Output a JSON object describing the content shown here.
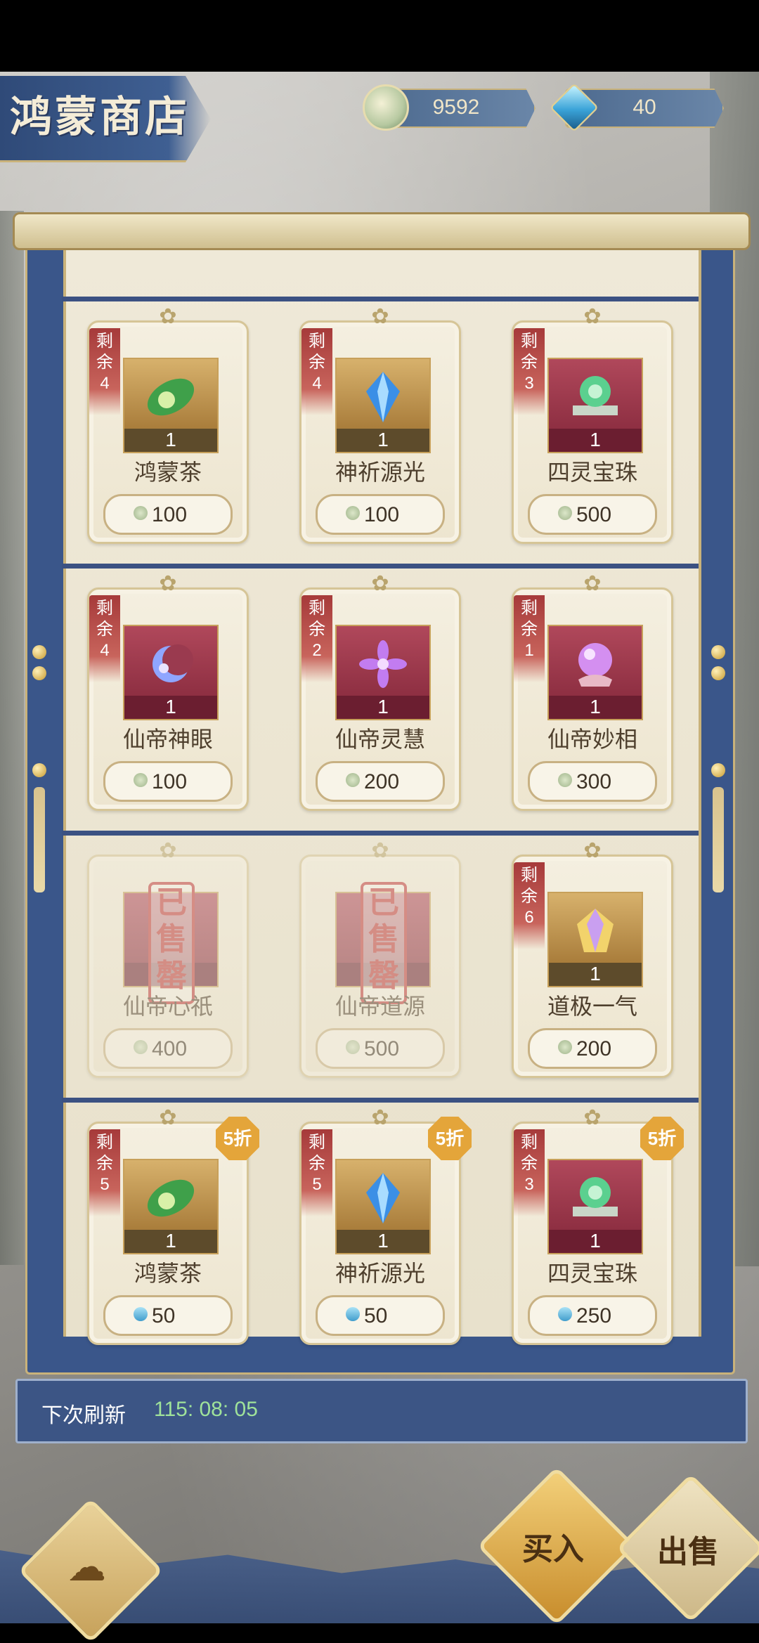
{
  "header": {
    "title": "鸿蒙商店",
    "currencies": [
      {
        "icon": "jade-coin-icon",
        "value": "9592"
      },
      {
        "icon": "gem-icon",
        "value": "40"
      }
    ]
  },
  "shop": {
    "items": [
      {
        "remain_label": "剩余",
        "remain": "4",
        "qty": "1",
        "name": "鸿蒙茶",
        "price": "100",
        "currency": "jade-coin-icon",
        "sold": false
      },
      {
        "remain_label": "剩余",
        "remain": "4",
        "qty": "1",
        "name": "神祈源光",
        "price": "100",
        "currency": "jade-coin-icon",
        "sold": false
      },
      {
        "remain_label": "剩余",
        "remain": "3",
        "qty": "1",
        "name": "四灵宝珠",
        "price": "500",
        "currency": "jade-coin-icon",
        "sold": false
      },
      {
        "remain_label": "剩余",
        "remain": "4",
        "qty": "1",
        "name": "仙帝神眼",
        "price": "100",
        "currency": "jade-coin-icon",
        "sold": false
      },
      {
        "remain_label": "剩余",
        "remain": "2",
        "qty": "1",
        "name": "仙帝灵慧",
        "price": "200",
        "currency": "jade-coin-icon",
        "sold": false
      },
      {
        "remain_label": "剩余",
        "remain": "1",
        "qty": "1",
        "name": "仙帝妙相",
        "price": "300",
        "currency": "jade-coin-icon",
        "sold": false
      },
      {
        "stamp": "已售罄",
        "name": "仙帝心祇",
        "price": "400",
        "currency": "jade-coin-icon",
        "sold": true
      },
      {
        "stamp": "已售罄",
        "name": "仙帝道源",
        "price": "500",
        "currency": "jade-coin-icon",
        "sold": true
      },
      {
        "remain_label": "剩余",
        "remain": "6",
        "qty": "1",
        "name": "道极一气",
        "price": "200",
        "currency": "jade-coin-icon",
        "sold": false
      },
      {
        "remain_label": "剩余",
        "remain": "5",
        "qty": "1",
        "name": "鸿蒙茶",
        "price": "50",
        "currency": "gem-icon",
        "discount": "5折",
        "sold": false
      },
      {
        "remain_label": "剩余",
        "remain": "5",
        "qty": "1",
        "name": "神祈源光",
        "price": "50",
        "currency": "gem-icon",
        "discount": "5折",
        "sold": false
      },
      {
        "remain_label": "剩余",
        "remain": "3",
        "qty": "1",
        "name": "四灵宝珠",
        "price": "250",
        "currency": "gem-icon",
        "discount": "5折",
        "sold": false
      }
    ]
  },
  "refresh": {
    "label": "下次刷新",
    "time": "115: 08: 05"
  },
  "actions": {
    "buy": "买入",
    "sell": "出售"
  },
  "colors": {
    "accent_blue": "#3a568a",
    "gold": "#c9b27a",
    "timer_green": "#9fe29a",
    "discount_orange": "#e4a53a"
  }
}
